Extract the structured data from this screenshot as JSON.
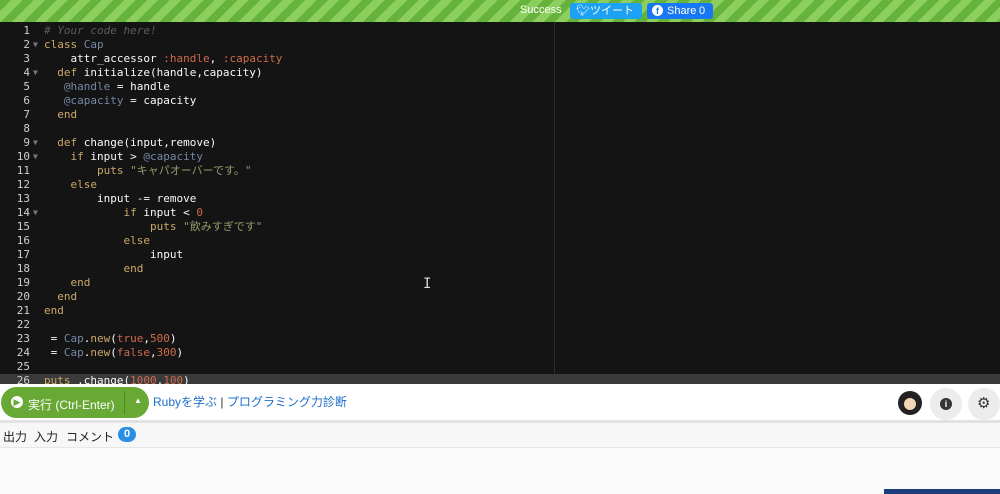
{
  "topbar": {
    "status": "Success",
    "tweet_label": "ツイート",
    "tweet_icon": "twitter-bird-icon",
    "share_label": "Share",
    "share_count": "0",
    "share_icon": "facebook-icon",
    "colors": {
      "stripe_light": "#8ccf5e",
      "stripe_dark": "#66b33b",
      "tweet": "#1da1f2",
      "share": "#1877f2"
    }
  },
  "editor": {
    "theme_colors": {
      "background": "#141414",
      "comment": "#5f5a60",
      "keyword": "#cda869",
      "constant": "#cf6a4c",
      "string": "#8f9d6a",
      "ivar": "#7587a6"
    },
    "lines": [
      {
        "n": "1",
        "text": "# Your code here!"
      },
      {
        "n": "2",
        "text": "class Cap"
      },
      {
        "n": "3",
        "text": "    attr_accessor :handle, :capacity"
      },
      {
        "n": "4",
        "text": "  def initialize(handle,capacity)"
      },
      {
        "n": "5",
        "text": "   @handle = handle"
      },
      {
        "n": "6",
        "text": "   @capacity = capacity"
      },
      {
        "n": "7",
        "text": "  end"
      },
      {
        "n": "8",
        "text": ""
      },
      {
        "n": "9",
        "text": "  def change(input,remove)"
      },
      {
        "n": "10",
        "text": "    if input > @capacity"
      },
      {
        "n": "11",
        "text": "        puts \"キャパオーバーです。\""
      },
      {
        "n": "12",
        "text": "    else"
      },
      {
        "n": "13",
        "text": "        input -= remove"
      },
      {
        "n": "14",
        "text": "            if input < 0"
      },
      {
        "n": "15",
        "text": "                puts \"飲みすぎです\""
      },
      {
        "n": "16",
        "text": "            else"
      },
      {
        "n": "17",
        "text": "                input"
      },
      {
        "n": "18",
        "text": "            end"
      },
      {
        "n": "19",
        "text": "    end"
      },
      {
        "n": "20",
        "text": "  end"
      },
      {
        "n": "21",
        "text": "end"
      },
      {
        "n": "22",
        "text": ""
      },
      {
        "n": "23",
        "text": "cup_1 = Cap.new(true,500)"
      },
      {
        "n": "24",
        "text": "cup_2 = Cap.new(false,300)"
      },
      {
        "n": "25",
        "text": ""
      },
      {
        "n": "26",
        "text": "puts cup_1.change(1000,100)"
      }
    ]
  },
  "toolbar": {
    "run_label": "実行 (Ctrl-Enter)",
    "run_icon": "play-circle-icon",
    "dropdown_icon": "caret-up-icon",
    "link_learn": "Rubyを学ぶ",
    "link_sep": "|",
    "link_diag": "プログラミング力診断",
    "info_icon": "info-icon",
    "gear_icon": "gear-icon",
    "run_color": "#68a834"
  },
  "output": {
    "tab_output": "出力",
    "tab_input": "入力",
    "tab_comment": "コメント",
    "comment_count": "0"
  }
}
